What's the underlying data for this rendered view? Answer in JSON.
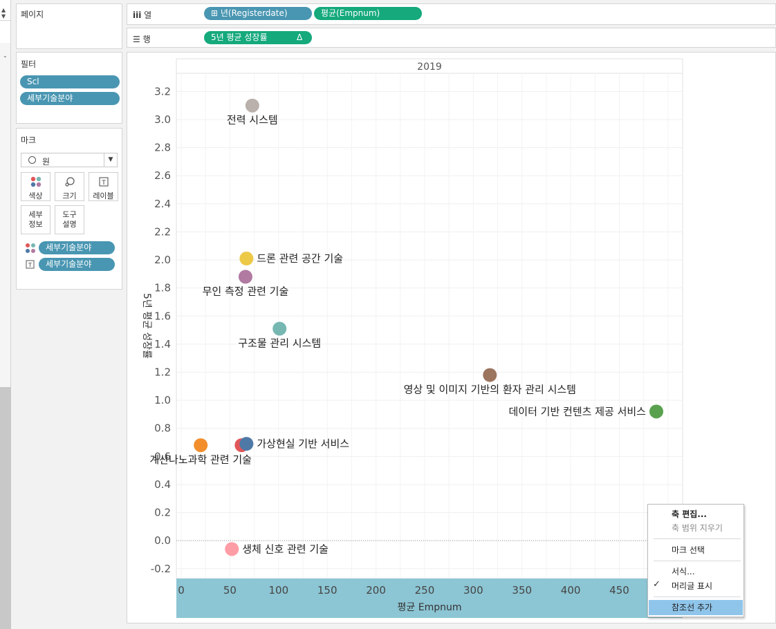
{
  "left_panel": {
    "pages": {
      "title": "페이지"
    },
    "filters": {
      "title": "필터",
      "items": [
        "Scl",
        "세부기술분야"
      ]
    },
    "marks": {
      "title": "마크",
      "mark_type": "원",
      "buttons": {
        "color": "색상",
        "size": "크기",
        "label": "레이블",
        "detail": "세부\n정보",
        "tooltip": "도구\n설명"
      },
      "fields": [
        {
          "encoding": "color",
          "name": "세부기술분야"
        },
        {
          "encoding": "label",
          "name": "세부기술분야"
        }
      ]
    }
  },
  "shelves": {
    "columns": {
      "label": "열",
      "pills": [
        "⊞ 년(Registerdate)",
        "평균(Empnum)"
      ]
    },
    "rows": {
      "label": "행",
      "pills": [
        "5년 평균 성장률"
      ],
      "delta": "Δ"
    }
  },
  "chart_data": {
    "type": "scatter",
    "header": "2019",
    "xlabel": "평균 Empnum",
    "ylabel": "5년 평균 성장률",
    "xlim": [
      -5,
      515
    ],
    "ylim": [
      -0.27,
      3.33
    ],
    "x_ticks": [
      0,
      50,
      100,
      150,
      200,
      250,
      300,
      350,
      400,
      450
    ],
    "y_ticks": [
      -0.2,
      0.0,
      0.2,
      0.4,
      0.6,
      0.8,
      1.0,
      1.2,
      1.4,
      1.6,
      1.8,
      2.0,
      2.2,
      2.4,
      2.6,
      2.8,
      3.0,
      3.2
    ],
    "grid": true,
    "zero_line": true,
    "points": [
      {
        "label": "전력 시스템",
        "x": 73,
        "y": 3.1,
        "color": "#bab0ac",
        "label_pos": "below"
      },
      {
        "label": "드론 관련 공간 기술",
        "x": 67,
        "y": 2.01,
        "color": "#edc948",
        "label_pos": "right"
      },
      {
        "label": "무인 측정 관련 기술",
        "x": 66,
        "y": 1.88,
        "color": "#b07aa1",
        "label_pos": "below"
      },
      {
        "label": "구조물 관리 시스템",
        "x": 101,
        "y": 1.51,
        "color": "#76b7b2",
        "label_pos": "below"
      },
      {
        "label": "영상 및 이미지 기반의 환자 관리 시스템",
        "x": 317,
        "y": 1.18,
        "color": "#9c755f",
        "label_pos": "below"
      },
      {
        "label": "데이터 기반 컨텐츠 제공 서비스",
        "x": 488,
        "y": 0.92,
        "color": "#59a14f",
        "label_pos": "left"
      },
      {
        "label": "계산나노과학 관련 기술",
        "x": 20,
        "y": 0.68,
        "color": "#f28e2b",
        "label_pos": "below"
      },
      {
        "label": "",
        "x": 62,
        "y": 0.68,
        "color": "#e15759",
        "label_pos": "none"
      },
      {
        "label": "가상현실 기반 서비스",
        "x": 67,
        "y": 0.69,
        "color": "#4e79a7",
        "label_pos": "right"
      },
      {
        "label": "생체 신호 관련 기술",
        "x": 52,
        "y": -0.06,
        "color": "#ff9da7",
        "label_pos": "right"
      }
    ]
  },
  "context_menu": {
    "items": [
      "축 편집...",
      "축 범위 지우기",
      "마크 선택",
      "서식...",
      "머리글 표시",
      "참조선 추가"
    ],
    "check": "✓"
  }
}
